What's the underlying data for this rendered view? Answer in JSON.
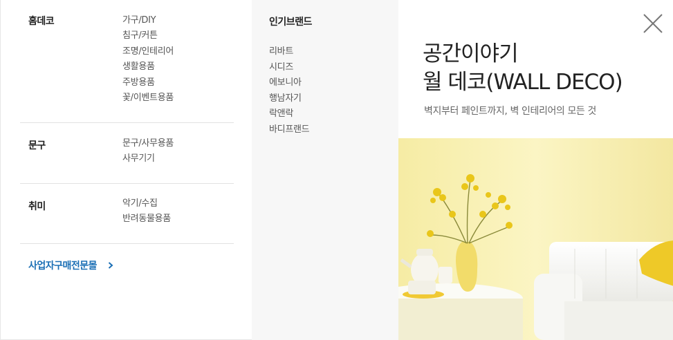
{
  "categories": [
    {
      "title": "홈데코",
      "links": [
        "가구/DIY",
        "침구/커튼",
        "조명/인테리어",
        "생활용품",
        "주방용품",
        "꽃/이벤트용품"
      ]
    },
    {
      "title": "문구",
      "links": [
        "문구/사무용품",
        "사무기기"
      ]
    },
    {
      "title": "취미",
      "links": [
        "악기/수집",
        "반려동물용품"
      ]
    }
  ],
  "special_link": {
    "label": "사업자구매전문몰",
    "icon": "chevron-right-icon",
    "color": "#1b6fb5"
  },
  "brands": {
    "title": "인기브랜드",
    "items": [
      "리바트",
      "시디즈",
      "에보니아",
      "행남자기",
      "락앤락",
      "바디프랜드"
    ]
  },
  "banner": {
    "title_line1": "공간이야기",
    "title_line2": "월 데코(WALL DECO)",
    "subtitle": "벽지부터 페인트까지, 벽 인테리어의 모든 것",
    "image": "yellow-room-with-white-sofa-and-flowers"
  },
  "close": {
    "icon": "close-icon"
  }
}
